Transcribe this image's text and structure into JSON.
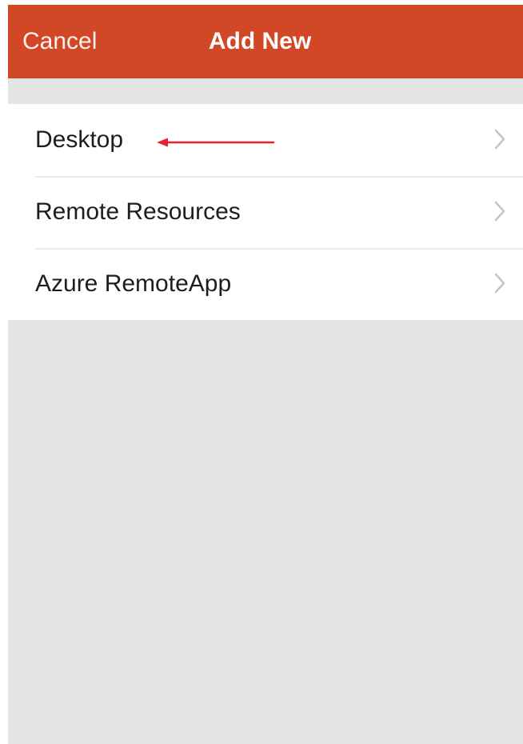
{
  "navbar": {
    "cancel_label": "Cancel",
    "title": "Add New"
  },
  "menu": {
    "items": [
      {
        "label": "Desktop"
      },
      {
        "label": "Remote Resources"
      },
      {
        "label": "Azure RemoteApp"
      }
    ]
  },
  "colors": {
    "brand": "#d24726",
    "background": "#e5e5e5",
    "annotation_arrow": "#e8212a"
  },
  "icons": {
    "row_disclosure": "chevron-right-icon",
    "annotation": "arrow-left-icon"
  }
}
